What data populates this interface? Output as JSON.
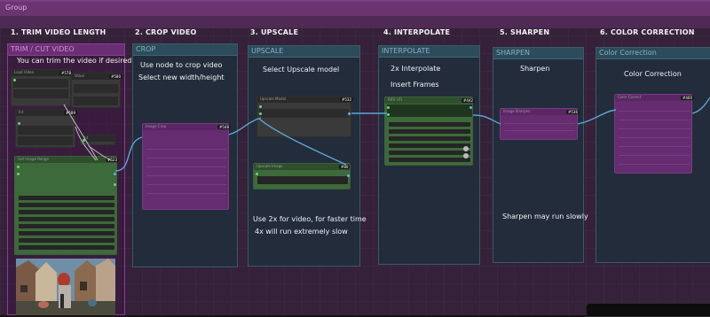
{
  "group": {
    "title": "Group"
  },
  "steps": {
    "s1": "1. TRIM VIDEO LENGTH",
    "s2": "2. CROP VIDEO",
    "s3": "3. UPSCALE",
    "s4": "4. INTERPOLATE",
    "s5": "5. SHARPEN",
    "s6": "6. COLOR CORRECTION"
  },
  "panels": {
    "trim": {
      "title": "TRIM / CUT VIDEO",
      "note": "You can trim the video if desired"
    },
    "crop": {
      "title": "CROP",
      "note1": "Use node to crop video",
      "note2": "Select new width/height"
    },
    "upscale": {
      "title": "UPSCALE",
      "note1": "Select Upscale model",
      "note2": "Use 2x for video, for faster time",
      "note3": "4x will run extremely slow"
    },
    "interpolate": {
      "title": "INTERPOLATE",
      "note1": "2x Interpolate",
      "note2": "Insert Frames"
    },
    "sharpen": {
      "title": "SHARPEN",
      "note1": "Sharpen",
      "note2": "Sharpen may run slowly"
    },
    "color": {
      "title": "Color Correction",
      "note1": "Color Correction"
    }
  },
  "badges": {
    "b1": "#578",
    "b2": "#580",
    "b3": "#589",
    "b4": "#523",
    "b5": "#548",
    "b6": "#532",
    "b7": "#80",
    "b8": "#442",
    "b9": "#536",
    "b10": "#400",
    "b11": "#400"
  },
  "node_titles": {
    "load": "Load Video",
    "fps": "Value",
    "skip": "Int",
    "frames": "Int",
    "trim": "Get Image Range",
    "crop": "Image Crop",
    "upmodel": "Upscale Model",
    "upscale": "Upscale Image",
    "rife": "RIFE VFI",
    "sharpen": "Image Sharpen",
    "colorcorrect": "Color Correct"
  },
  "colors": {
    "group": "#6a3570",
    "panel": "#2c4c5c",
    "green_node": "#3d6a3a",
    "purple_node": "#652c70",
    "wire": "#5aa6d6"
  }
}
